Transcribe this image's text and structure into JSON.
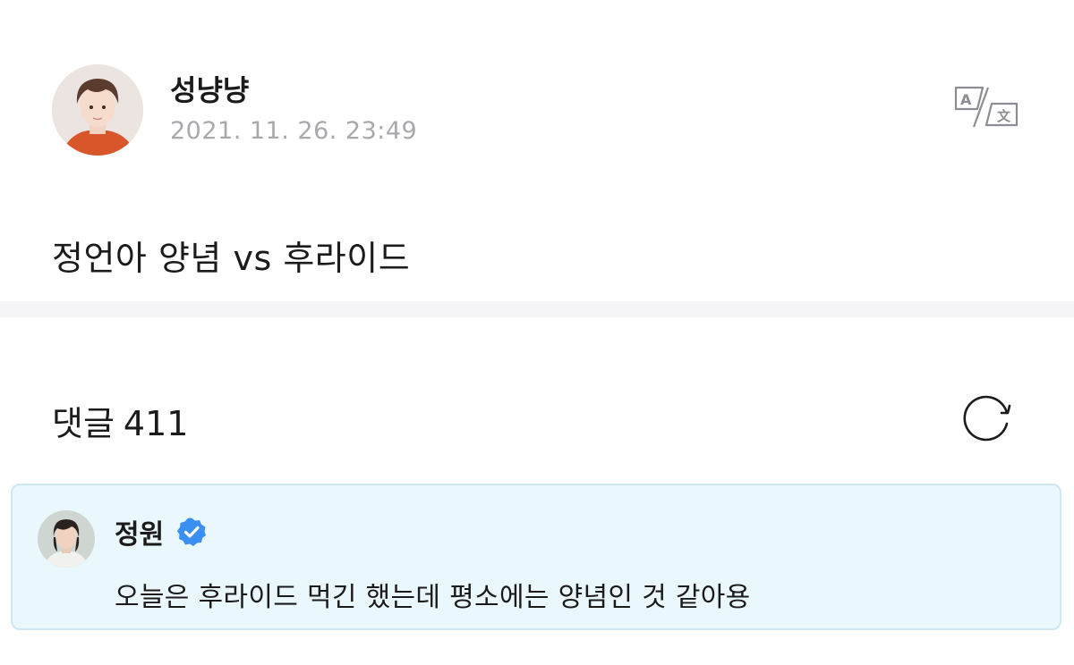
{
  "post": {
    "author_name": "성냥냥",
    "date": "2021. 11. 26. 23:49",
    "body": "정언아 양념 vs 후라이드",
    "translate_icon": "translate-icon"
  },
  "comments": {
    "label": "댓글",
    "count": "411",
    "refresh_icon": "refresh-icon"
  },
  "highlighted_comment": {
    "author_name": "정원",
    "verified": true,
    "text": "오늘은 후라이드 먹긴 했는데 평소에는 양념인 것 같아용"
  },
  "colors": {
    "date_gray": "#a9a9ad",
    "divider": "#f5f5f8",
    "comment_bg": "#eaf7fd",
    "comment_border": "#cfe7f3",
    "verified_blue": "#3a8ff2"
  }
}
